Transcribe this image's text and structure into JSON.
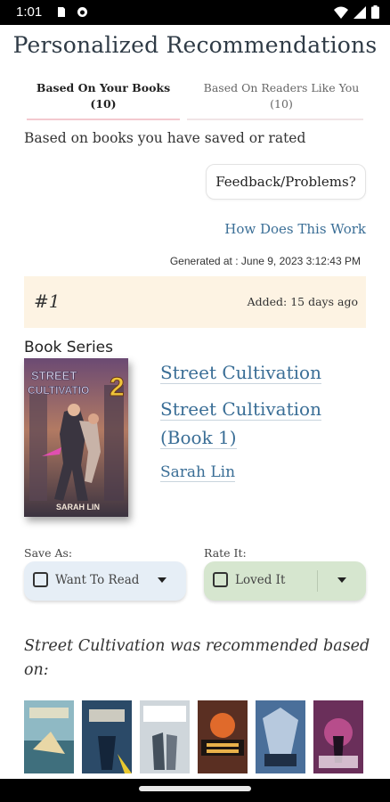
{
  "status_bar": {
    "time": "1:01"
  },
  "page": {
    "title": "Personalized Recommendations",
    "tabs": [
      {
        "label": "Based On Your Books",
        "count": "(10)"
      },
      {
        "label": "Based On Readers Like You",
        "count": "(10)"
      }
    ],
    "subtitle": "Based on books you have saved or rated",
    "feedback_label": "Feedback/Problems?",
    "how_link": "How Does This Work",
    "generated": "Generated at : June 9, 2023 3:12:43 PM"
  },
  "recommendation": {
    "rank": "#1",
    "added": "Added: 15 days ago",
    "series_label": "Book Series",
    "series_title": "Street Cultivation",
    "book_title_line1": "Street Cultivation",
    "book_title_line2": "(Book 1)",
    "author": "Sarah Lin",
    "cover": {
      "title_text": "STREET CULTIVATION",
      "number": "2",
      "author_text": "SARAH LIN"
    },
    "save_as": {
      "label": "Save As:",
      "value": "Want To Read"
    },
    "rate_it": {
      "label": "Rate It:",
      "value": "Loved It"
    },
    "based_on_line1": "Street Cultivation was recommended based",
    "based_on_line2": "on:"
  },
  "colors": {
    "accent_link": "#3a6e96",
    "tab_underline_active": "#f3c9cf",
    "tab_underline_inactive": "#f1e4e6",
    "rank_bg": "#fdf3e3",
    "save_bg": "#e6eef6",
    "rate_bg": "#d6e6cf"
  }
}
